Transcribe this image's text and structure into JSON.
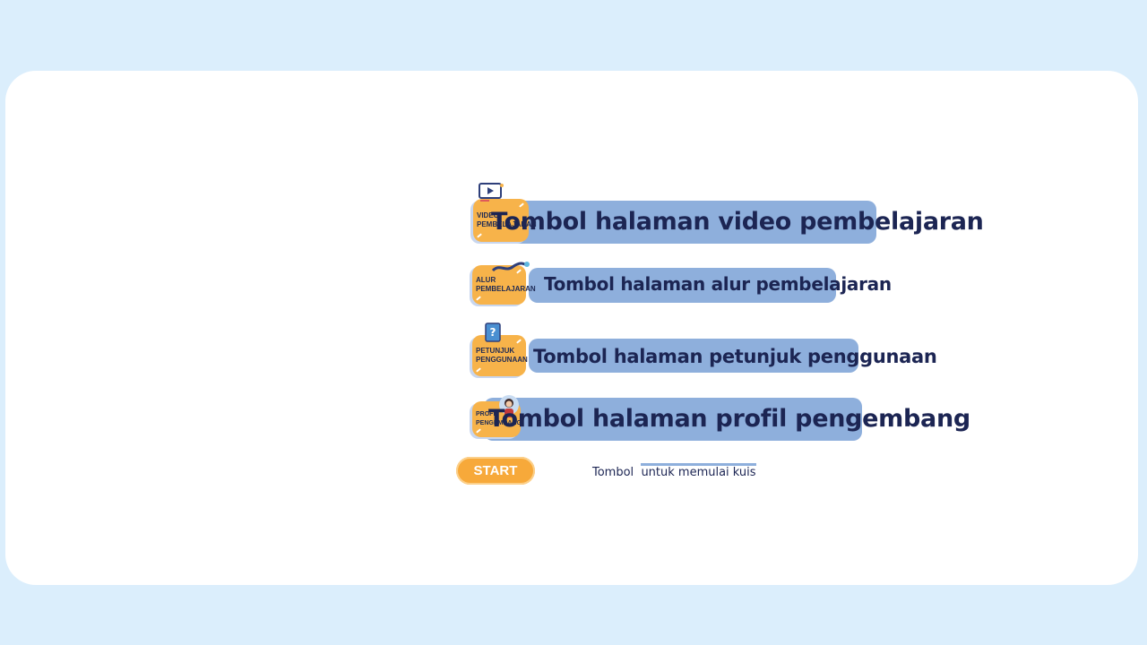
{
  "menu": [
    {
      "icon_label": "VIDEO PEMBELAJARAN",
      "icon": "video-icon",
      "description": "Tombol  halaman video pembelajaran"
    },
    {
      "icon_label": "ALUR PEMBELAJARAN",
      "icon": "path-icon",
      "description": "Tombol  halaman alur pembelajaran"
    },
    {
      "icon_label": "PETUNJUK PENGGUNAAN",
      "icon": "question-book-icon",
      "description": "Tombol  halaman petunjuk penggunaan"
    },
    {
      "icon_label": "PROFIL PENGEMBANG",
      "icon": "person-avatar-icon",
      "description": "Tombol  halaman profil pengembang"
    }
  ],
  "start": {
    "label": "START",
    "note_prefix": "Tombol  ",
    "note_highlight": "untuk memulai kuis"
  },
  "colors": {
    "background": "#dbeefc",
    "card": "#ffffff",
    "button_orange": "#f7b34a",
    "label_bar": "#8eafdc",
    "text_navy": "#1c2553"
  }
}
